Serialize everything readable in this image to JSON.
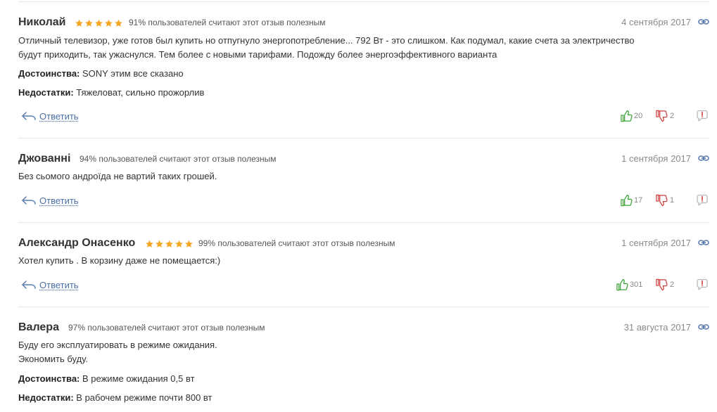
{
  "colors": {
    "star": "#f5a623",
    "vote_up": "#3aa334",
    "vote_down": "#d23a3a",
    "link": "#4a6fa5",
    "date": "#8a8a8a"
  },
  "labels": {
    "reply": "Ответить",
    "pros": "Достоинства:",
    "cons": "Недостатки:"
  },
  "icons": {
    "star": "star-icon",
    "permalink": "link-icon",
    "reply": "reply-arrow-icon",
    "thumbs_up": "thumbs-up-icon",
    "thumbs_down": "thumbs-down-icon",
    "complain": "complaint-icon"
  },
  "reviews": [
    {
      "author": "Николай",
      "rating": 5,
      "helpful": "91% пользователей считают этот отзыв полезным",
      "date": "4 сентября 2017",
      "text_lines": [
        "Отличный телевизор, уже готов был купить но отпугнуло энергопотребление... 792 Вт - это слишком. Как подумал, какие счета за электричество",
        "будут приходить, так ужаснулся. Тем более с новыми тарифами. Подожду более энергоэффективного варианта"
      ],
      "pros": "SONY этим все сказано",
      "cons": "Тяжеловат, сильно прожорлив",
      "likes": "20",
      "dislikes": "2"
    },
    {
      "author": "Джованні",
      "helpful": "94% пользователей считают этот отзыв полезным",
      "date": "1 сентября 2017",
      "text_lines": [
        "Без сьомого андроїда не вартий таких грошей."
      ],
      "likes": "17",
      "dislikes": "1"
    },
    {
      "author": "Александр Онасенко",
      "rating": 5,
      "helpful": "99% пользователей считают этот отзыв полезным",
      "date": "1 сентября 2017",
      "text_lines": [
        "Хотел купить . В корзину даже не помещается:)"
      ],
      "likes": "301",
      "dislikes": "2"
    },
    {
      "author": "Валера",
      "helpful": "97% пользователей считают этот отзыв полезным",
      "date": "31 августа 2017",
      "text_lines": [
        "Буду его эксплуатировать в режиме ожидания.",
        "Экономить буду."
      ],
      "pros": "В режиме ожидания 0,5 вт",
      "cons": "В рабочем режиме почти 800 вт"
    }
  ]
}
